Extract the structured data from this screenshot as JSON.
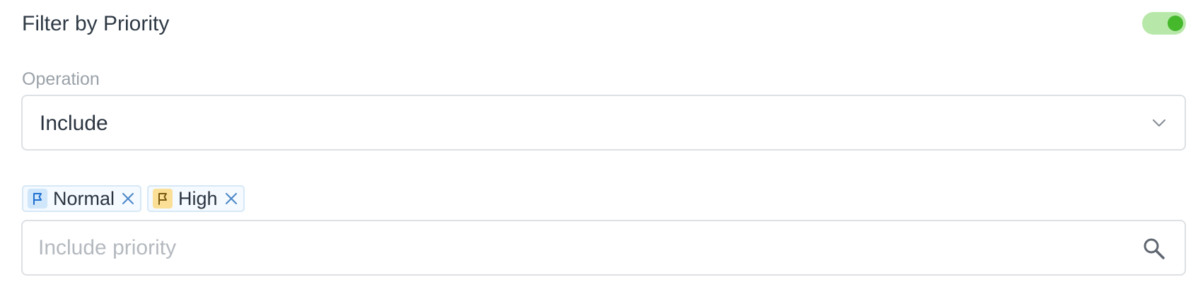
{
  "filter": {
    "title": "Filter by Priority",
    "enabled": true
  },
  "operation": {
    "label": "Operation",
    "selected": "Include"
  },
  "chips": [
    {
      "label": "Normal",
      "flag_icon": "flag-icon",
      "flag_color": "#1f6fd1",
      "flag_bg": "#cfe6fb"
    },
    {
      "label": "High",
      "flag_icon": "flag-icon",
      "flag_color": "#7a5a10",
      "flag_bg": "#fbdf96"
    }
  ],
  "search": {
    "placeholder": "Include priority",
    "value": ""
  },
  "colors": {
    "toggle_on": "#45b82c",
    "toggle_track": "#b8e8a9",
    "chip_remove": "#4a86c8"
  }
}
